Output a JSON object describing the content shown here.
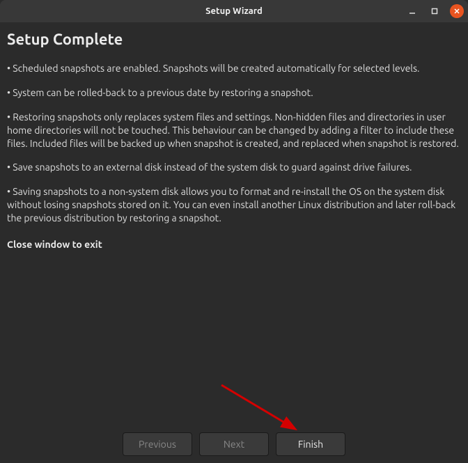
{
  "window": {
    "title": "Setup Wizard"
  },
  "content": {
    "heading": "Setup Complete",
    "bullets": [
      "• Scheduled snapshots are enabled. Snapshots will be created automatically for selected levels.",
      "• System can be rolled-back to a previous date by restoring a snapshot.",
      "• Restoring snapshots only replaces system files and settings. Non-hidden files and directories in user home directories will not be touched. This behaviour can be changed by adding a filter to include these files. Included files will be backed up when snapshot is created, and replaced when snapshot is restored.",
      "• Save snapshots to an external disk instead of the system disk to guard against drive failures.",
      "• Saving snapshots to a non-system disk allows you to format and re-install the OS on the system disk without losing snapshots stored on it. You can even install another Linux distribution and later roll-back the previous distribution by restoring a snapshot."
    ],
    "exit_text": "Close window to exit"
  },
  "buttons": {
    "previous": "Previous",
    "next": "Next",
    "finish": "Finish"
  },
  "annotation": {
    "arrow_target": "finish-button"
  }
}
